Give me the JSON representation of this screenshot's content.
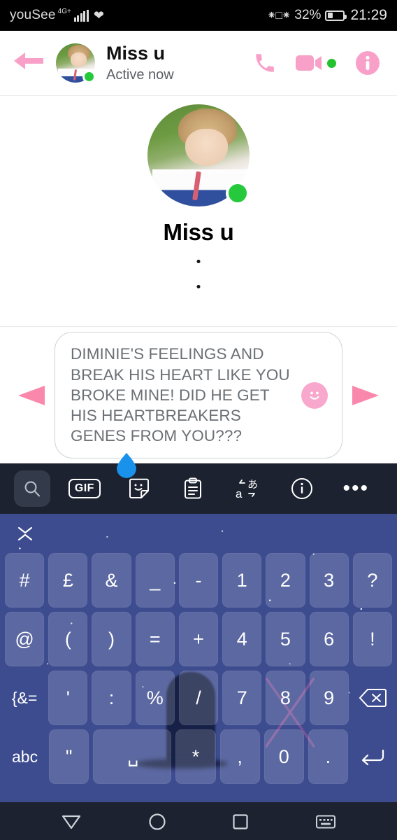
{
  "status_bar": {
    "carrier": "youSee",
    "network": "4G+",
    "heart_icon": "heart-icon",
    "vibrate_icon": "vibrate-icon",
    "battery_percent": "32%",
    "battery_level": 32,
    "time": "21:29"
  },
  "header": {
    "back_icon": "back-arrow-icon",
    "title": "Miss u",
    "subtitle": "Active now",
    "call_icon": "phone-icon",
    "video_icon": "video-camera-icon",
    "info_icon": "info-circle-icon",
    "online_badge": "online-status-dot"
  },
  "profile": {
    "name": "Miss u",
    "online_badge": "online-status-dot",
    "dots": [
      ".",
      "."
    ]
  },
  "composer": {
    "prev_arrow_icon": "arrow-left-icon",
    "next_arrow_icon": "send-arrow-icon",
    "message_text": "DIMINIE'S FEELINGS AND BREAK HIS HEART LIKE YOU BROKE MINE! DID HE GET HIS HEARTBREAKERS GENES FROM YOU???",
    "emoji_icon": "smiley-face-icon",
    "cursor_handle_icon": "text-cursor-handle-icon"
  },
  "keyboard_toolbar": {
    "items": [
      {
        "name": "search-icon",
        "label": ""
      },
      {
        "name": "gif-button",
        "label": "GIF"
      },
      {
        "name": "sticker-icon",
        "label": ""
      },
      {
        "name": "clipboard-icon",
        "label": ""
      },
      {
        "name": "translate-icon",
        "label": ""
      },
      {
        "name": "info-icon",
        "label": ""
      },
      {
        "name": "more-options-icon",
        "label": "•••"
      }
    ]
  },
  "keyboard": {
    "collapse_icon": "collapse-keyboard-icon",
    "rows": [
      [
        "#",
        "£",
        "&",
        "_",
        "-",
        "1",
        "2",
        "3",
        "?"
      ],
      [
        "@",
        "(",
        ")",
        "=",
        "+",
        "4",
        "5",
        "6",
        "!"
      ],
      [
        "{&=",
        "'",
        ":",
        "%",
        "/",
        "7",
        "8",
        "9",
        "⌫"
      ],
      [
        "abc",
        "\"",
        "␣",
        "*",
        ",",
        "0",
        ".",
        "↵"
      ]
    ],
    "symbol_switch_label": "{&=",
    "alpha_switch_label": "abc",
    "backspace_icon": "backspace-icon",
    "enter_icon": "enter-key-icon",
    "space_icon": "space-bar-icon"
  },
  "nav_bar": {
    "back_icon": "nav-back-icon",
    "home_icon": "nav-home-icon",
    "recents_icon": "nav-recents-icon",
    "hide_keyboard_icon": "hide-keyboard-icon"
  },
  "colors": {
    "accent_pink": "#f9a0c8",
    "online_green": "#25c93b",
    "cursor_blue": "#1a92ec",
    "toolbar_dark": "#1d2230"
  }
}
